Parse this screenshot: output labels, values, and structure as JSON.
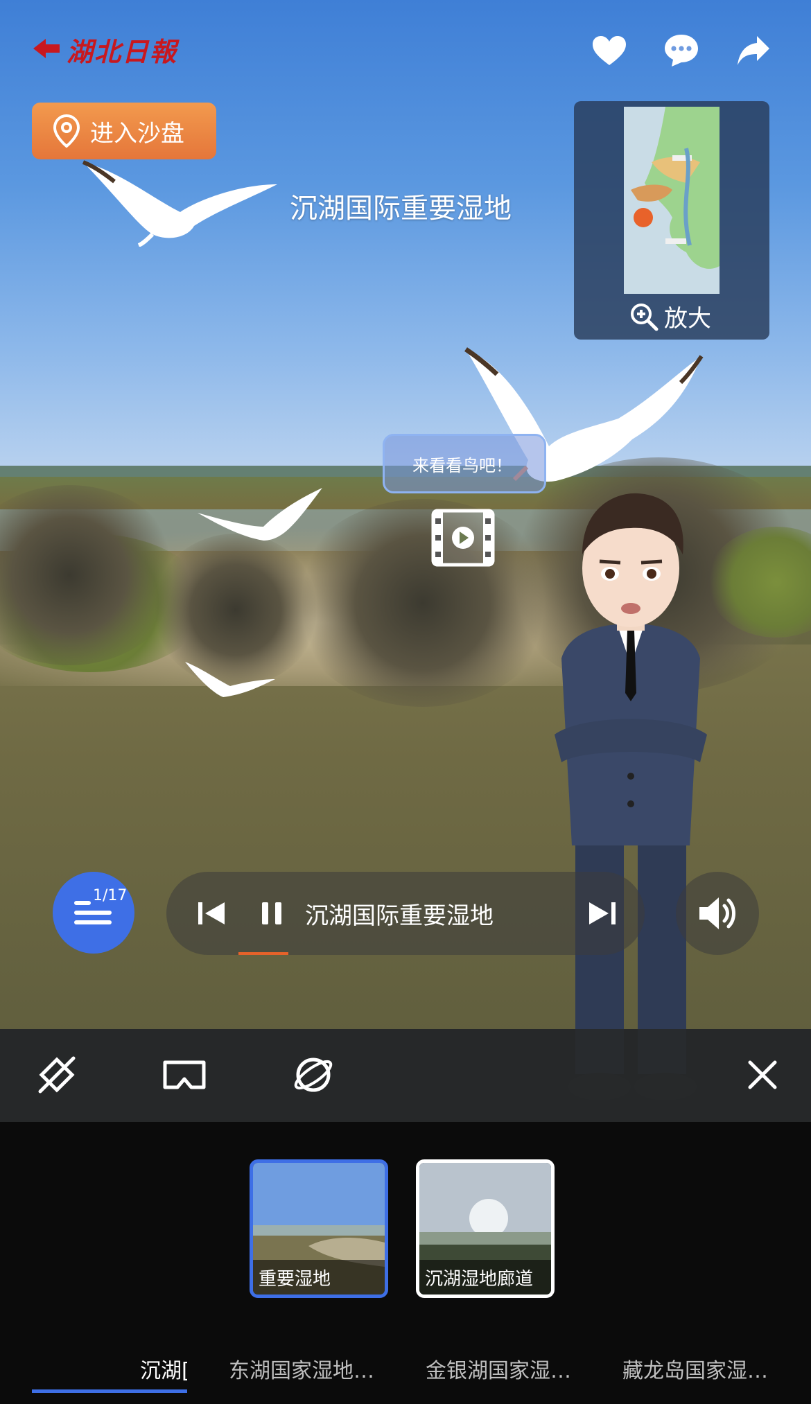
{
  "header": {
    "logo_text": "湖北日報",
    "icons": [
      "heart-icon",
      "comment-icon",
      "share-icon"
    ]
  },
  "sand_button": {
    "label": "进入沙盘",
    "icon": "location-pin-icon"
  },
  "scene": {
    "title": "沉湖国际重要湿地"
  },
  "minimap": {
    "zoom_label": "放大"
  },
  "hotspot": {
    "label": "来看看鸟吧！"
  },
  "player": {
    "playlist_count": "1/17",
    "title": "沉湖国际重要湿地",
    "progress": 0.1
  },
  "thumbnails": [
    {
      "caption": "重要湿地",
      "active": true
    },
    {
      "caption": "沉湖湿地廊道",
      "active": false
    }
  ],
  "tabs": [
    {
      "label": "沉湖[",
      "active": true
    },
    {
      "label": "东湖国家湿地…",
      "active": false
    },
    {
      "label": "金银湖国家湿…",
      "active": false
    },
    {
      "label": "藏龙岛国家湿…",
      "active": false
    }
  ],
  "colors": {
    "accent": "#3e6fe6",
    "brand_red": "#c8181e",
    "sand_orange": "#ee8a45",
    "progress": "#e6622a"
  }
}
